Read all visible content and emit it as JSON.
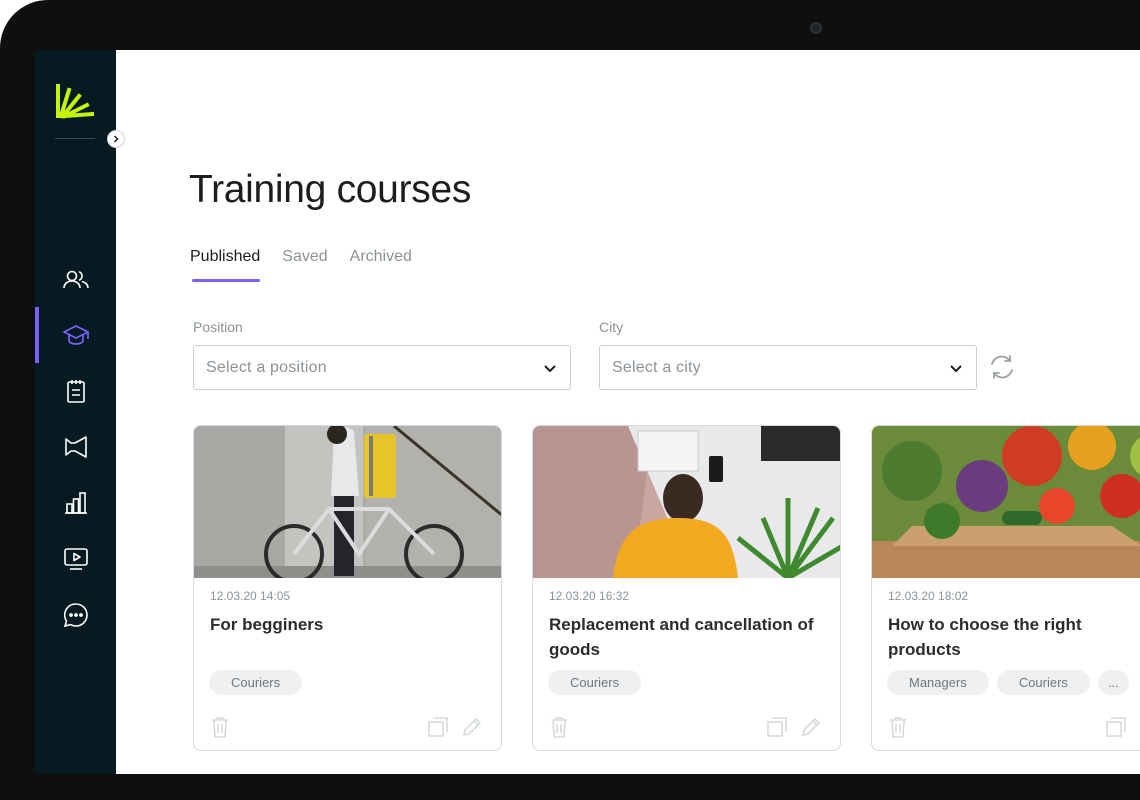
{
  "colors": {
    "accent": "#7b61ff",
    "sidebar": "#061a22",
    "logo": "#c5f40c"
  },
  "sidebar": {
    "items": [
      {
        "icon": "users-icon"
      },
      {
        "icon": "graduation-cap-icon",
        "active": true
      },
      {
        "icon": "clipboard-icon"
      },
      {
        "icon": "megaphone-icon"
      },
      {
        "icon": "bar-chart-icon"
      },
      {
        "icon": "video-icon"
      },
      {
        "icon": "chat-icon"
      }
    ]
  },
  "main": {
    "title": "Training courses",
    "tabs": [
      {
        "label": "Published",
        "active": true
      },
      {
        "label": "Saved"
      },
      {
        "label": "Archived"
      }
    ]
  },
  "filters": {
    "position": {
      "label": "Position",
      "placeholder": "Select a position"
    },
    "city": {
      "label": "City",
      "placeholder": "Select a city"
    }
  },
  "courses": [
    {
      "date": "12.03.20 14:05",
      "title": "For begginers",
      "tags": [
        "Couriers"
      ]
    },
    {
      "date": "12.03.20 16:32",
      "title": "Replacement and cancellation of goods",
      "tags": [
        "Couriers"
      ]
    },
    {
      "date": "12.03.20 18:02",
      "title": "How to choose the right products",
      "tags": [
        "Managers",
        "Couriers",
        "..."
      ]
    }
  ]
}
